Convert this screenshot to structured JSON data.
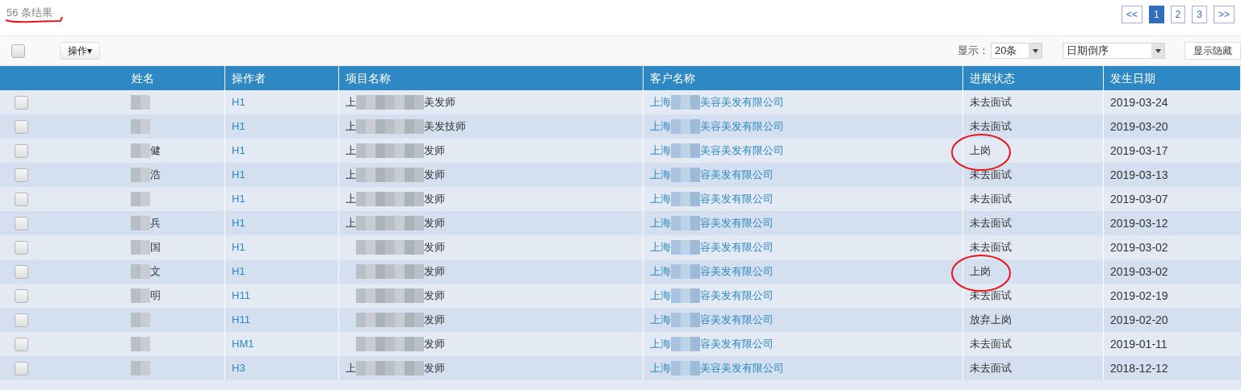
{
  "result_count": {
    "text": "56 条结果",
    "underlined": true
  },
  "pagination": [
    {
      "label": "<<",
      "selected": false
    },
    {
      "label": "1",
      "selected": true
    },
    {
      "label": "2",
      "selected": false
    },
    {
      "label": "3",
      "selected": false
    },
    {
      "label": ">>",
      "selected": false
    }
  ],
  "toolbar": {
    "select_all_checked": false,
    "action_button": "操作▾",
    "page_size_label": "显示：",
    "page_size": "20条",
    "sort": "日期倒序",
    "toggle_columns_button": "显示隐藏"
  },
  "table": {
    "columns": [
      "姓名",
      "操作者",
      "项目名称",
      "客户名称",
      "进展状态",
      "发生日期"
    ],
    "rows": [
      {
        "checked": false,
        "name": "",
        "operator": "H1",
        "project_head": "上",
        "project_tail": "美发师",
        "client_head": "上海",
        "client_tail": "美容美发有限公司",
        "status": "未去面试",
        "date": "2019-03-24",
        "highlighted": false
      },
      {
        "checked": false,
        "name": "",
        "operator": "H1",
        "project_head": "上",
        "project_tail": "美发技师",
        "client_head": "上海",
        "client_tail": "美容美发有限公司",
        "status": "未去面试",
        "date": "2019-03-20",
        "highlighted": false
      },
      {
        "checked": false,
        "name": "健",
        "operator": "H1",
        "project_head": "上",
        "project_tail": "发师",
        "client_head": "上海",
        "client_tail": "美容美发有限公司",
        "status": "上岗",
        "date": "2019-03-17",
        "highlighted": true
      },
      {
        "checked": false,
        "name": "浩",
        "operator": "H1",
        "project_head": "上",
        "project_tail": "发师",
        "client_head": "上海",
        "client_tail": "容美发有限公司",
        "status": "未去面试",
        "date": "2019-03-13",
        "highlighted": false
      },
      {
        "checked": false,
        "name": "",
        "operator": "H1",
        "project_head": "上",
        "project_tail": "发师",
        "client_head": "上海",
        "client_tail": "容美发有限公司",
        "status": "未去面试",
        "date": "2019-03-07",
        "highlighted": false
      },
      {
        "checked": false,
        "name": "兵",
        "operator": "H1",
        "project_head": "上",
        "project_tail": "发师",
        "client_head": "上海",
        "client_tail": "容美发有限公司",
        "status": "未去面试",
        "date": "2019-03-12",
        "highlighted": false
      },
      {
        "checked": false,
        "name": "国",
        "operator": "H1",
        "project_head": "",
        "project_tail": "发师",
        "client_head": "上海",
        "client_tail": "容美发有限公司",
        "status": "未去面试",
        "date": "2019-03-02",
        "highlighted": false
      },
      {
        "checked": false,
        "name": "文",
        "operator": "H1",
        "project_head": "",
        "project_tail": "发师",
        "client_head": "上海",
        "client_tail": "容美发有限公司",
        "status": "上岗",
        "date": "2019-03-02",
        "highlighted": true
      },
      {
        "checked": false,
        "name": "明",
        "operator": "H11",
        "project_head": "",
        "project_tail": "发师",
        "client_head": "上海",
        "client_tail": "容美发有限公司",
        "status": "未去面试",
        "date": "2019-02-19",
        "highlighted": false
      },
      {
        "checked": false,
        "name": "",
        "operator": "H11",
        "project_head": "",
        "project_tail": "发师",
        "client_head": "上海",
        "client_tail": "容美发有限公司",
        "status": "放弃上岗",
        "date": "2019-02-20",
        "highlighted": false
      },
      {
        "checked": false,
        "name": "",
        "operator": "HM1",
        "project_head": "",
        "project_tail": "发师",
        "client_head": "上海",
        "client_tail": "容美发有限公司",
        "status": "未去面试",
        "date": "2019-01-11",
        "highlighted": false
      },
      {
        "checked": false,
        "name": "",
        "operator": "H3",
        "project_head": "上",
        "project_tail": "发师",
        "client_head": "上海",
        "client_tail": "美容美发有限公司",
        "status": "未去面试",
        "date": "2018-12-12",
        "highlighted": false
      }
    ]
  }
}
